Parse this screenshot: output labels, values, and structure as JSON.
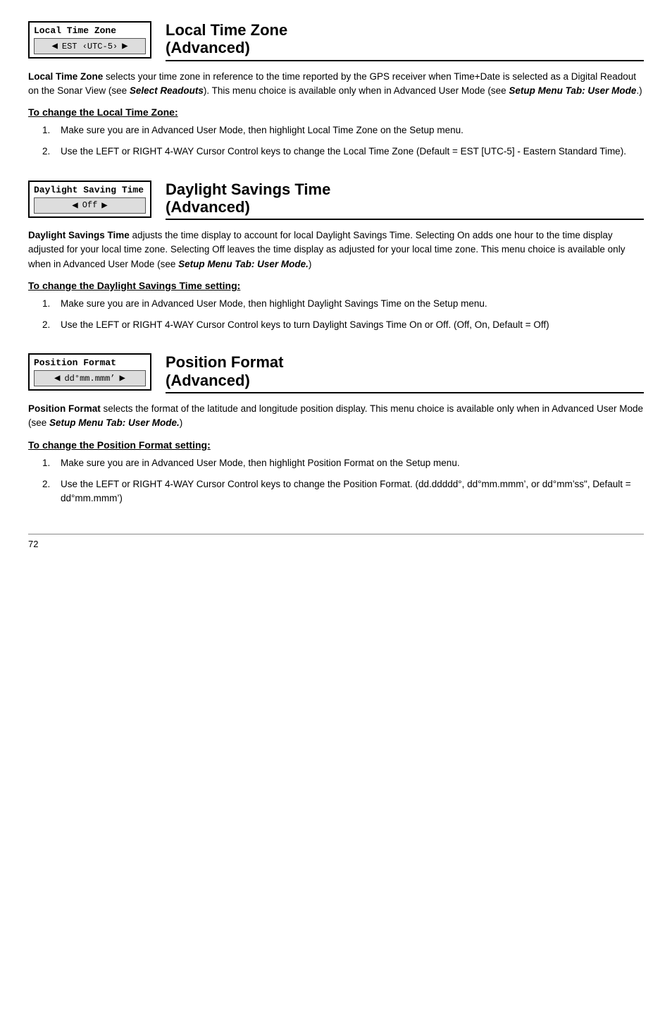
{
  "page": {
    "page_number": "72"
  },
  "sections": [
    {
      "id": "local-time-zone",
      "widget": {
        "label": "Local Time Zone",
        "value": "EST ‹UTC-5›"
      },
      "title_line1": "Local Time Zone",
      "title_line2": "(Advanced)",
      "body": "<b>Local Time Zone</b> selects your time zone in reference to the time reported by the GPS receiver when Time+Date is selected as a Digital Readout on the Sonar View (see <b><i>Select Readouts</i></b>).  This menu choice is available only when in Advanced User Mode (see <b><i>Setup Menu Tab: User Mode</i></b>.)",
      "subsection_heading": "To change the Local Time Zone:",
      "instructions": [
        "Make sure you are in Advanced User Mode, then highlight Local Time Zone on the Setup menu.",
        "Use the LEFT or RIGHT 4-WAY Cursor Control keys to change the Local Time Zone (Default = EST [UTC-5] - Eastern Standard Time)."
      ]
    },
    {
      "id": "daylight-savings-time",
      "widget": {
        "label": "Daylight Saving Time",
        "value": "Off"
      },
      "title_line1": "Daylight Savings Time",
      "title_line2": "(Advanced)",
      "body": "<b>Daylight Savings Time</b> adjusts the time display to account for local Daylight Savings Time. Selecting On adds one hour to the time display adjusted for your local time zone.  Selecting Off leaves the time display as adjusted for your local time zone. This menu choice is available only when in Advanced User Mode (see <b><i>Setup Menu Tab: User Mode.</i></b>)",
      "subsection_heading": "To change the Daylight Savings Time setting:",
      "instructions": [
        "Make sure you are in Advanced User Mode, then highlight Daylight Savings Time on the Setup menu.",
        "Use the LEFT or RIGHT 4-WAY Cursor Control keys to turn Daylight Savings Time On or Off. (Off, On, Default = Off)"
      ]
    },
    {
      "id": "position-format",
      "widget": {
        "label": "Position Format",
        "value": "dd°mm.mmm’"
      },
      "title_line1": "Position Format",
      "title_line2": "(Advanced)",
      "body": "<b>Position Format</b> selects the format of the latitude and longitude position display.  This menu choice is available only when in Advanced User Mode (see <b><i>Setup Menu Tab: User Mode.</i></b>)",
      "subsection_heading": "To change the Position Format setting:",
      "instructions": [
        "Make sure you are in Advanced User Mode, then highlight Position Format on the Setup menu.",
        "Use the LEFT or RIGHT 4-WAY Cursor Control keys to change the Position Format. (dd.ddddd°, dd°mm.mmm’, or dd°mm’ss\", Default = dd°mm.mmm’)"
      ]
    }
  ]
}
